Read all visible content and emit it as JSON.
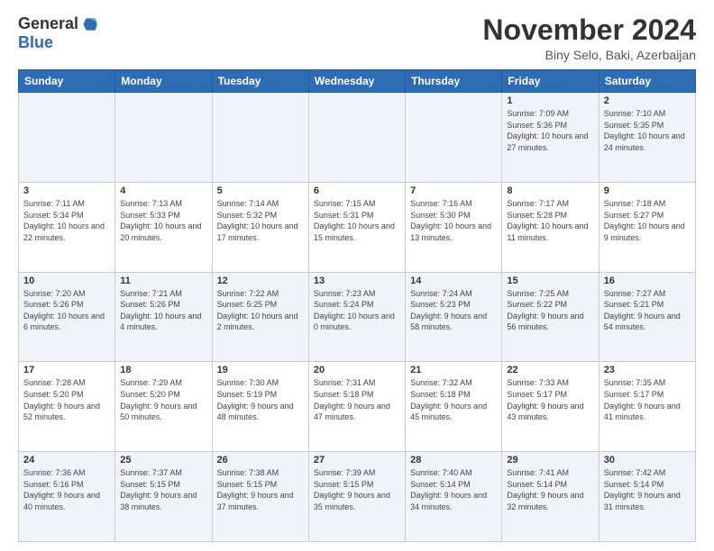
{
  "logo": {
    "general": "General",
    "blue": "Blue"
  },
  "header": {
    "title": "November 2024",
    "location": "Biny Selo, Baki, Azerbaijan"
  },
  "days_of_week": [
    "Sunday",
    "Monday",
    "Tuesday",
    "Wednesday",
    "Thursday",
    "Friday",
    "Saturday"
  ],
  "weeks": [
    [
      {
        "day": "",
        "info": ""
      },
      {
        "day": "",
        "info": ""
      },
      {
        "day": "",
        "info": ""
      },
      {
        "day": "",
        "info": ""
      },
      {
        "day": "",
        "info": ""
      },
      {
        "day": "1",
        "info": "Sunrise: 7:09 AM\nSunset: 5:36 PM\nDaylight: 10 hours and 27 minutes."
      },
      {
        "day": "2",
        "info": "Sunrise: 7:10 AM\nSunset: 5:35 PM\nDaylight: 10 hours and 24 minutes."
      }
    ],
    [
      {
        "day": "3",
        "info": "Sunrise: 7:11 AM\nSunset: 5:34 PM\nDaylight: 10 hours and 22 minutes."
      },
      {
        "day": "4",
        "info": "Sunrise: 7:13 AM\nSunset: 5:33 PM\nDaylight: 10 hours and 20 minutes."
      },
      {
        "day": "5",
        "info": "Sunrise: 7:14 AM\nSunset: 5:32 PM\nDaylight: 10 hours and 17 minutes."
      },
      {
        "day": "6",
        "info": "Sunrise: 7:15 AM\nSunset: 5:31 PM\nDaylight: 10 hours and 15 minutes."
      },
      {
        "day": "7",
        "info": "Sunrise: 7:16 AM\nSunset: 5:30 PM\nDaylight: 10 hours and 13 minutes."
      },
      {
        "day": "8",
        "info": "Sunrise: 7:17 AM\nSunset: 5:28 PM\nDaylight: 10 hours and 11 minutes."
      },
      {
        "day": "9",
        "info": "Sunrise: 7:18 AM\nSunset: 5:27 PM\nDaylight: 10 hours and 9 minutes."
      }
    ],
    [
      {
        "day": "10",
        "info": "Sunrise: 7:20 AM\nSunset: 5:26 PM\nDaylight: 10 hours and 6 minutes."
      },
      {
        "day": "11",
        "info": "Sunrise: 7:21 AM\nSunset: 5:26 PM\nDaylight: 10 hours and 4 minutes."
      },
      {
        "day": "12",
        "info": "Sunrise: 7:22 AM\nSunset: 5:25 PM\nDaylight: 10 hours and 2 minutes."
      },
      {
        "day": "13",
        "info": "Sunrise: 7:23 AM\nSunset: 5:24 PM\nDaylight: 10 hours and 0 minutes."
      },
      {
        "day": "14",
        "info": "Sunrise: 7:24 AM\nSunset: 5:23 PM\nDaylight: 9 hours and 58 minutes."
      },
      {
        "day": "15",
        "info": "Sunrise: 7:25 AM\nSunset: 5:22 PM\nDaylight: 9 hours and 56 minutes."
      },
      {
        "day": "16",
        "info": "Sunrise: 7:27 AM\nSunset: 5:21 PM\nDaylight: 9 hours and 54 minutes."
      }
    ],
    [
      {
        "day": "17",
        "info": "Sunrise: 7:28 AM\nSunset: 5:20 PM\nDaylight: 9 hours and 52 minutes."
      },
      {
        "day": "18",
        "info": "Sunrise: 7:29 AM\nSunset: 5:20 PM\nDaylight: 9 hours and 50 minutes."
      },
      {
        "day": "19",
        "info": "Sunrise: 7:30 AM\nSunset: 5:19 PM\nDaylight: 9 hours and 48 minutes."
      },
      {
        "day": "20",
        "info": "Sunrise: 7:31 AM\nSunset: 5:18 PM\nDaylight: 9 hours and 47 minutes."
      },
      {
        "day": "21",
        "info": "Sunrise: 7:32 AM\nSunset: 5:18 PM\nDaylight: 9 hours and 45 minutes."
      },
      {
        "day": "22",
        "info": "Sunrise: 7:33 AM\nSunset: 5:17 PM\nDaylight: 9 hours and 43 minutes."
      },
      {
        "day": "23",
        "info": "Sunrise: 7:35 AM\nSunset: 5:17 PM\nDaylight: 9 hours and 41 minutes."
      }
    ],
    [
      {
        "day": "24",
        "info": "Sunrise: 7:36 AM\nSunset: 5:16 PM\nDaylight: 9 hours and 40 minutes."
      },
      {
        "day": "25",
        "info": "Sunrise: 7:37 AM\nSunset: 5:15 PM\nDaylight: 9 hours and 38 minutes."
      },
      {
        "day": "26",
        "info": "Sunrise: 7:38 AM\nSunset: 5:15 PM\nDaylight: 9 hours and 37 minutes."
      },
      {
        "day": "27",
        "info": "Sunrise: 7:39 AM\nSunset: 5:15 PM\nDaylight: 9 hours and 35 minutes."
      },
      {
        "day": "28",
        "info": "Sunrise: 7:40 AM\nSunset: 5:14 PM\nDaylight: 9 hours and 34 minutes."
      },
      {
        "day": "29",
        "info": "Sunrise: 7:41 AM\nSunset: 5:14 PM\nDaylight: 9 hours and 32 minutes."
      },
      {
        "day": "30",
        "info": "Sunrise: 7:42 AM\nSunset: 5:14 PM\nDaylight: 9 hours and 31 minutes."
      }
    ]
  ]
}
